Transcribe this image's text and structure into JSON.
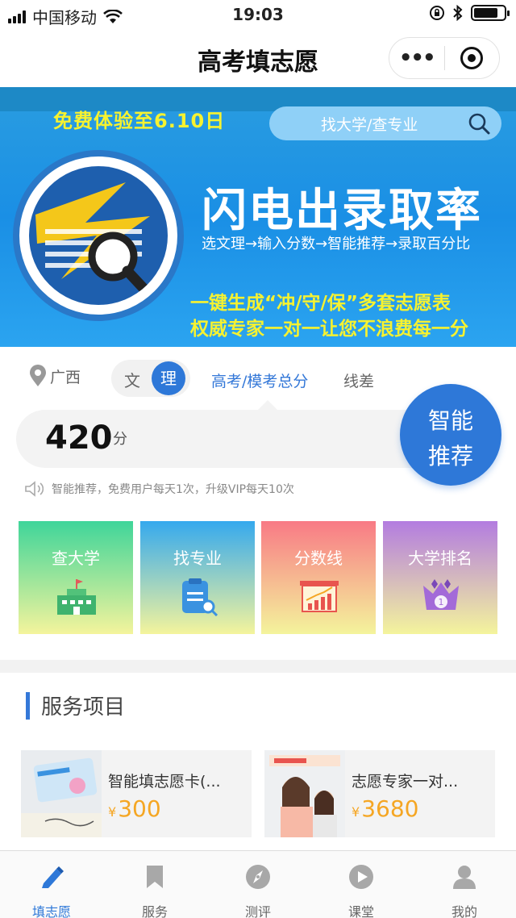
{
  "status_bar": {
    "carrier": "中国移动",
    "time": "19:03",
    "battery_level": 0.8
  },
  "nav": {
    "title": "高考填志愿",
    "more_glyph": "•••"
  },
  "banner": {
    "free_trial": "免费体验至6.10日",
    "search_placeholder": "找大学/查专业",
    "headline": "闪电出录取率",
    "subline": "选文理→输入分数→智能推荐→录取百分比",
    "slogan_1": "一键生成“冲/守/保”多套志愿表",
    "slogan_2": "权威专家一对一让您不浪费每一分"
  },
  "selector": {
    "province": "广西",
    "stream_arts": "文",
    "stream_science": "理",
    "selected_stream": "理",
    "tab_score": "高考/模考总分",
    "tab_line": "线差"
  },
  "score": {
    "value": "420",
    "unit": "分"
  },
  "recommend_button": {
    "line1": "智能",
    "line2": "推荐"
  },
  "notice": "智能推荐，免费用户每天1次，升级VIP每天10次",
  "features": [
    {
      "label": "查大学",
      "icon": "school-building-icon"
    },
    {
      "label": "找专业",
      "icon": "clipboard-search-icon"
    },
    {
      "label": "分数线",
      "icon": "bar-chart-board-icon"
    },
    {
      "label": "大学排名",
      "icon": "rank-crown-icon"
    }
  ],
  "services": {
    "title": "服务项目",
    "items": [
      {
        "name": "智能填志愿卡(...",
        "currency": "¥",
        "price": "300"
      },
      {
        "name": "志愿专家一对...",
        "currency": "¥",
        "price": "3680"
      }
    ]
  },
  "tabbar": {
    "items": [
      {
        "label": "填志愿",
        "icon": "pencil-icon",
        "active": true
      },
      {
        "label": "服务",
        "icon": "bookmark-icon",
        "active": false
      },
      {
        "label": "测评",
        "icon": "compass-icon",
        "active": false
      },
      {
        "label": "课堂",
        "icon": "play-icon",
        "active": false
      },
      {
        "label": "我的",
        "icon": "person-icon",
        "active": false
      }
    ]
  },
  "colors": {
    "accent": "#2e78d8",
    "price": "#f5a623",
    "banner_yellow": "#f6f230"
  }
}
